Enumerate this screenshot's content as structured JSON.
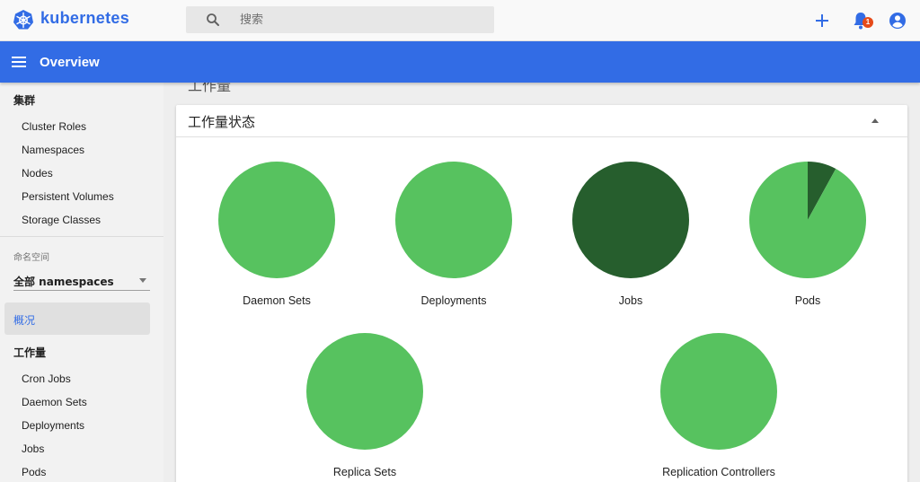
{
  "header": {
    "brand": "kubernetes",
    "search_placeholder": "搜索",
    "notification_count": "1",
    "icons": [
      "kubernetes-logo-icon",
      "search-icon",
      "plus-icon",
      "bell-icon",
      "account-icon"
    ]
  },
  "appbar": {
    "title": "Overview",
    "menu_icon": "menu-icon"
  },
  "sidebar": {
    "cluster_heading": "集群",
    "cluster_items": [
      {
        "label": "Cluster Roles"
      },
      {
        "label": "Namespaces"
      },
      {
        "label": "Nodes"
      },
      {
        "label": "Persistent Volumes"
      },
      {
        "label": "Storage Classes"
      }
    ],
    "namespace_label": "命名空间",
    "namespace_value": "全部 namespaces",
    "overview_label": "概况",
    "workloads_heading": "工作量",
    "workload_items": [
      {
        "label": "Cron Jobs"
      },
      {
        "label": "Daemon Sets"
      },
      {
        "label": "Deployments"
      },
      {
        "label": "Jobs"
      },
      {
        "label": "Pods"
      }
    ]
  },
  "main": {
    "section_heading": "工作量",
    "card_title": "工作量状态"
  },
  "colors": {
    "brand": "#326ce5",
    "running": "#57c25f",
    "succeeded": "#265e2d",
    "badge": "#e64a19"
  },
  "chart_data": {
    "type": "pie",
    "charts": [
      {
        "label": "Daemon Sets",
        "running": 1.0,
        "succeeded": 0.0
      },
      {
        "label": "Deployments",
        "running": 1.0,
        "succeeded": 0.0
      },
      {
        "label": "Jobs",
        "running": 0.0,
        "succeeded": 1.0
      },
      {
        "label": "Pods",
        "running": 0.92,
        "succeeded": 0.08
      },
      {
        "label": "Replica Sets",
        "running": 1.0,
        "succeeded": 0.0
      },
      {
        "label": "Replication Controllers",
        "running": 1.0,
        "succeeded": 0.0
      }
    ]
  }
}
